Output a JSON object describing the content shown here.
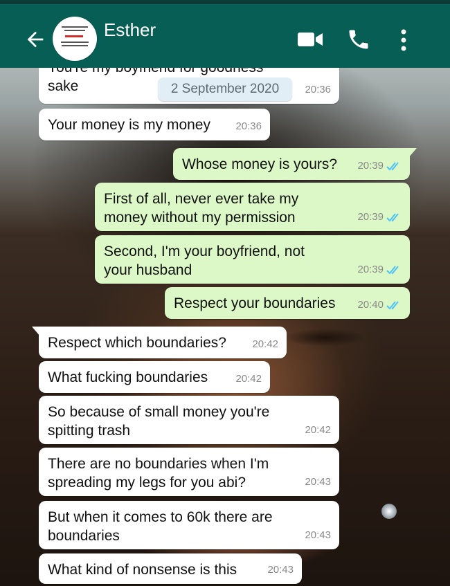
{
  "header": {
    "contact_name": "Esther",
    "avatar_caption": "",
    "icons": [
      "back-arrow-icon",
      "video-call-icon",
      "voice-call-icon",
      "more-options-icon"
    ]
  },
  "date_chip": "2 September 2020",
  "messages": [
    {
      "dir": "in",
      "text_lines": [
        "You're my boyfriend for goodness",
        "sake"
      ],
      "time": "20:36"
    },
    {
      "dir": "in",
      "text_lines": [
        "Your money is my money"
      ],
      "time": "20:36"
    },
    {
      "dir": "out",
      "text_lines": [
        "Whose money is yours?"
      ],
      "time": "20:39",
      "status": "read"
    },
    {
      "dir": "out",
      "text_lines": [
        "First of all, never ever take my",
        "money without my permission"
      ],
      "time": "20:39",
      "status": "read"
    },
    {
      "dir": "out",
      "text_lines": [
        "Second, I'm your boyfriend, not",
        "your husband"
      ],
      "time": "20:39",
      "status": "read"
    },
    {
      "dir": "out",
      "text_lines": [
        "Respect your boundaries"
      ],
      "time": "20:40",
      "status": "read"
    },
    {
      "dir": "in",
      "text_lines": [
        "Respect which boundaries?"
      ],
      "time": "20:42"
    },
    {
      "dir": "in",
      "text_lines": [
        "What fucking boundaries"
      ],
      "time": "20:42"
    },
    {
      "dir": "in",
      "text_lines": [
        "So because of small money you're",
        "spitting trash"
      ],
      "time": "20:42"
    },
    {
      "dir": "in",
      "text_lines": [
        "There are no boundaries when I'm",
        "spreading my legs for you abi?"
      ],
      "time": "20:43"
    },
    {
      "dir": "in",
      "text_lines": [
        "But when it comes to 60k there are",
        "boundaries"
      ],
      "time": "20:43"
    },
    {
      "dir": "in",
      "text_lines": [
        "What kind of nonsense is this"
      ],
      "time": "20:43"
    }
  ],
  "colors": {
    "appbar": "#075e54",
    "incoming_bubble": "#ffffff",
    "outgoing_bubble": "#dcf8c6",
    "read_ticks": "#4fc3f7",
    "date_chip": "#e1eef6"
  }
}
